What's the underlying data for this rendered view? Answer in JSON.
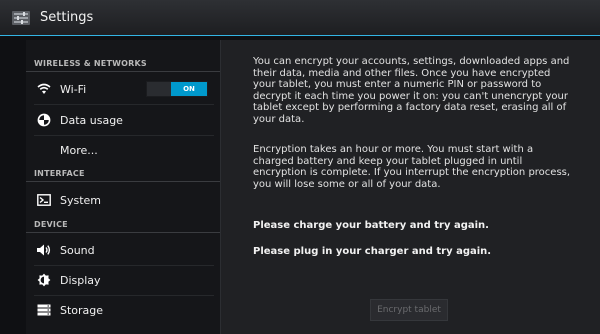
{
  "header": {
    "title": "Settings",
    "icon": "settings-icon",
    "accent": "#33b5e5"
  },
  "sidebar": {
    "sections": [
      {
        "header": "WIRELESS & NETWORKS",
        "items": [
          {
            "label": "Wi-Fi",
            "icon": "wifi-icon",
            "toggle": "ON"
          },
          {
            "label": "Data usage",
            "icon": "data-usage-icon"
          },
          {
            "label": "More...",
            "icon": ""
          }
        ]
      },
      {
        "header": "INTERFACE",
        "items": [
          {
            "label": "System",
            "icon": "system-icon"
          }
        ]
      },
      {
        "header": "DEVICE",
        "items": [
          {
            "label": "Sound",
            "icon": "sound-icon"
          },
          {
            "label": "Display",
            "icon": "display-icon"
          },
          {
            "label": "Storage",
            "icon": "storage-icon"
          }
        ]
      }
    ]
  },
  "main": {
    "para1": "You can encrypt your accounts, settings, downloaded apps and their data, media and other files. Once you have encrypted your tablet, you must enter a numeric PIN or password to decrypt it each time you power it on: you can't unencrypt your tablet except by performing a factory data reset, erasing all of your data.",
    "para2": "Encryption takes an hour or more. You must start with a charged battery and keep your tablet plugged in until encryption is complete. If you interrupt the encryption process, you will lose some or all of your data.",
    "warning_battery": "Please charge your battery and try again.",
    "warning_charger": "Please plug in your charger and try again.",
    "button_label": "Encrypt tablet",
    "button_enabled": false
  },
  "colors": {
    "toggle_on": "#0099cc"
  }
}
